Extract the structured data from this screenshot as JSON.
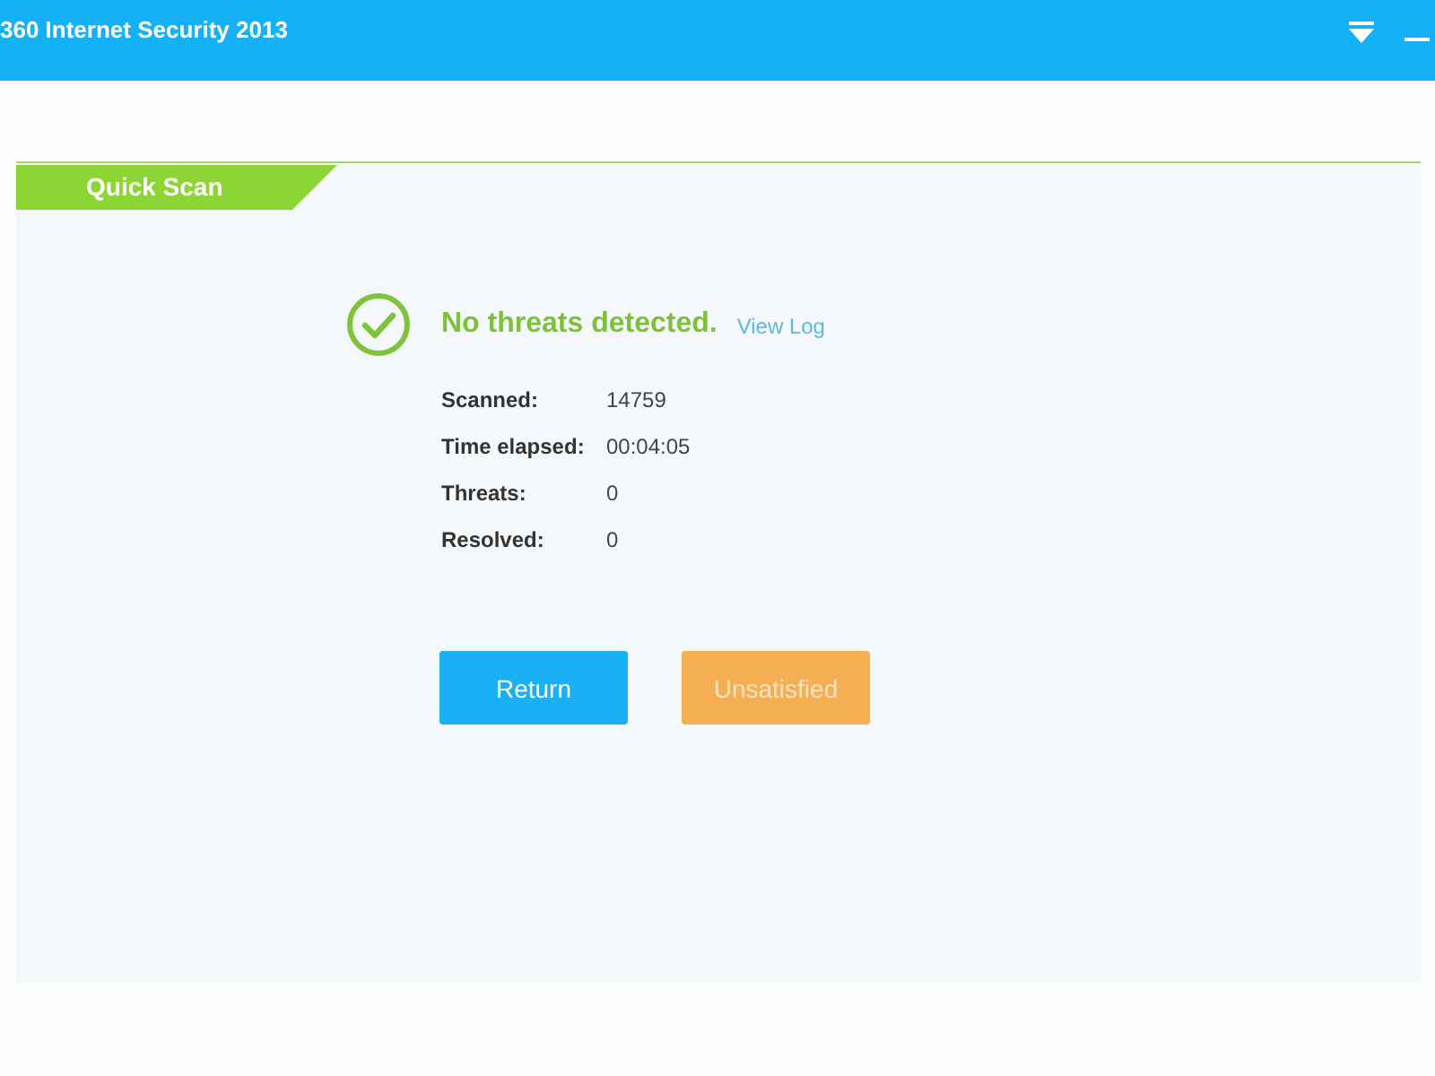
{
  "window": {
    "title": "360 Internet Security 2013"
  },
  "panel": {
    "tab": "Quick Scan"
  },
  "result": {
    "heading": "No threats detected.",
    "link": "View Log"
  },
  "stats": [
    {
      "label": "Scanned:",
      "value": "14759"
    },
    {
      "label": "Time elapsed:",
      "value": "00:04:05"
    },
    {
      "label": "Threats:",
      "value": "0"
    },
    {
      "label": "Resolved:",
      "value": "0"
    }
  ],
  "buttons": [
    {
      "label": "Return",
      "kind": "primary"
    },
    {
      "label": "Unsatisfied",
      "kind": "secondary"
    }
  ]
}
